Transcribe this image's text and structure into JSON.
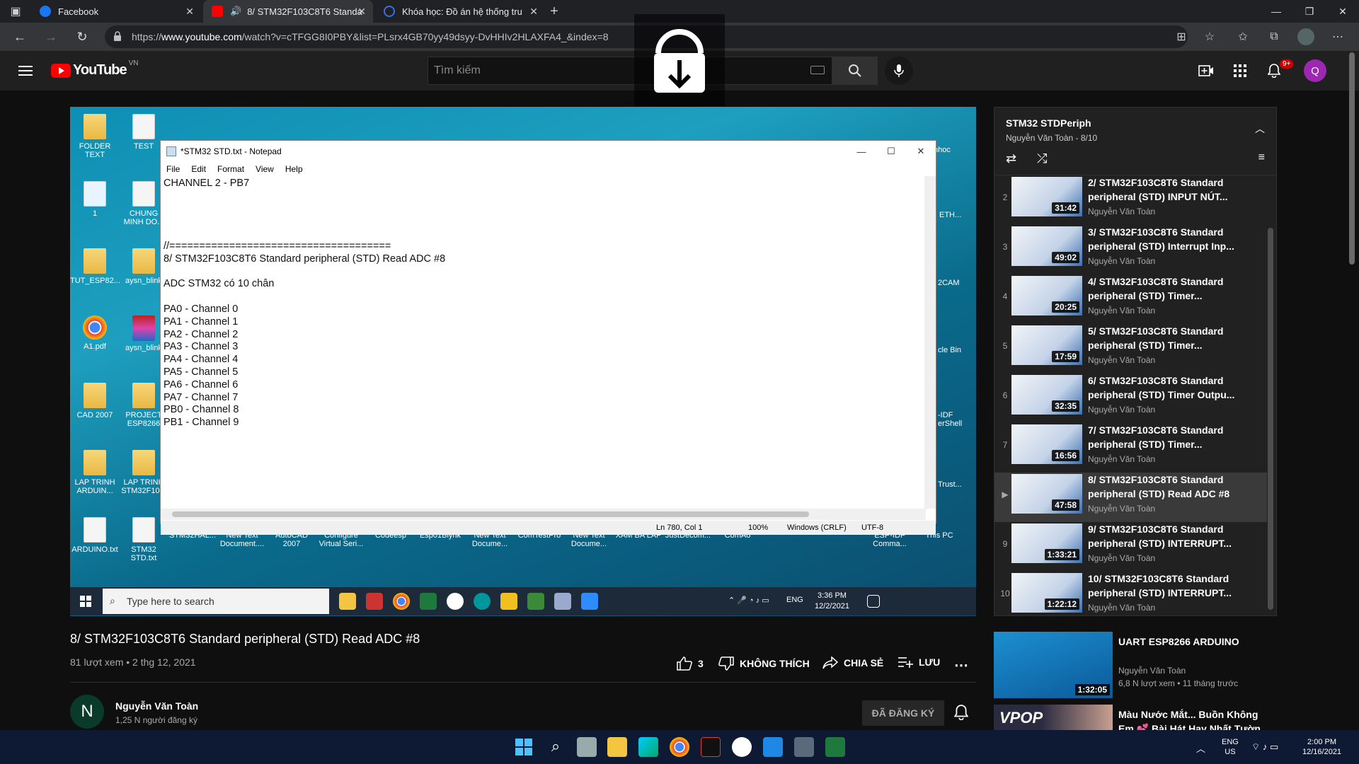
{
  "browser": {
    "tabs": [
      {
        "title": "Facebook",
        "color": "#1877f2"
      },
      {
        "title": "8/ STM32F103C8T6 Standa",
        "color": "#ff0000"
      },
      {
        "title": "Khóa học: Đồ án hệ thống truyề",
        "color": "#3b6fe0"
      }
    ],
    "url_prefix": "https://",
    "url_domain": "www.youtube.com",
    "url_path": "/watch?v=cTFGG8I0PBY&list=PLsrx4GB70yy49dsyy-DvHHIv2HLAXFA4_&index=8"
  },
  "youtube": {
    "logo_text": "YouTube",
    "country": "VN",
    "search_placeholder": "Tìm kiếm",
    "notif_badge": "9+",
    "avatar_letter": "Q"
  },
  "notepad": {
    "title": "*STM32 STD.txt - Notepad",
    "menu": [
      "File",
      "Edit",
      "Format",
      "View",
      "Help"
    ],
    "lines": [
      "CHANNEL 2 - PB7",
      "",
      "",
      "",
      "",
      "//=====================================",
      "8/ STM32F103C8T6 Standard peripheral (STD) Read ADC #8",
      "",
      "ADC STM32 có 10 chân",
      "",
      "PA0 - Channel 0",
      "PA1 - Channel 1",
      "PA2 - Channel 2",
      "PA3 - Channel 3",
      "PA4 - Channel 4",
      "PA5 - Channel 5",
      "PA6 - Channel 6",
      "PA7 - Channel 7",
      "PB0 - Channel 8",
      "PB1 - Channel 9"
    ],
    "status_pos": "Ln 780, Col 1",
    "status_zoom": "100%",
    "status_eol": "Windows (CRLF)",
    "status_enc": "UTF-8"
  },
  "desktop": {
    "icons": [
      {
        "label": "FOLDER TEXT"
      },
      {
        "label": "TEST"
      },
      {
        "label": "1"
      },
      {
        "label": "CHUNG MINH DO..."
      },
      {
        "label": "TUT_ESP82..."
      },
      {
        "label": "aysn_blink"
      },
      {
        "label": "A1.pdf"
      },
      {
        "label": "aysn_blink"
      },
      {
        "label": "CAD 2007"
      },
      {
        "label": "PROJECT ESP8266"
      },
      {
        "label": "LAP TRINH ARDUIN..."
      },
      {
        "label": "LAP TRINH STM32F10..."
      },
      {
        "label": "ARDUINO.txt"
      },
      {
        "label": "STM32 STD.txt"
      },
      {
        "label": "STM32HAL..."
      },
      {
        "label": "New Text Document...."
      },
      {
        "label": "AutoCAD 2007"
      },
      {
        "label": "Configure Virtual Seri..."
      },
      {
        "label": "Codeesp"
      },
      {
        "label": "Esp01Blynk"
      },
      {
        "label": "New Text Docume..."
      },
      {
        "label": "ComTestPro"
      },
      {
        "label": "New Text Docume..."
      },
      {
        "label": "XAM BA LAP"
      },
      {
        "label": "JustDecom..."
      },
      {
        "label": "ComAo"
      },
      {
        "label": "ESP-IDF Comma..."
      },
      {
        "label": "This PC"
      }
    ],
    "right_labels": [
      "nhoc",
      "ETH...",
      "2CAM",
      "cle Bin",
      "-IDF erShell",
      "Trust..."
    ],
    "search_placeholder": "Type here to search",
    "lang": "ENG",
    "time": "3:36 PM",
    "date": "12/2/2021"
  },
  "video": {
    "title": "8/ STM32F103C8T6 Standard peripheral (STD) Read ADC #8",
    "meta": "81 lượt xem • 2 thg 12, 2021",
    "likes": "3",
    "dislike_label": "KHÔNG THÍCH",
    "share_label": "CHIA SẺ",
    "save_label": "LƯU",
    "channel_name": "Nguyễn Văn Toàn",
    "channel_initial": "N",
    "subscribers": "1,25 N người đăng ký",
    "subscribed_label": "ĐÃ ĐĂNG KÝ"
  },
  "playlist": {
    "title": "STM32 STDPeriph",
    "subtitle": "Nguyễn Văn Toàn - 8/10",
    "items": [
      {
        "index": "2",
        "title": "2/ STM32F103C8T6 Standard peripheral (STD) INPUT NÚT...",
        "channel": "Nguyễn Văn Toàn",
        "duration": "31:42"
      },
      {
        "index": "3",
        "title": "3/ STM32F103C8T6 Standard peripheral (STD) Interrupt Inp...",
        "channel": "Nguyễn Văn Toàn",
        "duration": "49:02"
      },
      {
        "index": "4",
        "title": "4/ STM32F103C8T6 Standard peripheral (STD) Timer...",
        "channel": "Nguyễn Văn Toàn",
        "duration": "20:25"
      },
      {
        "index": "5",
        "title": "5/ STM32F103C8T6 Standard peripheral (STD) Timer...",
        "channel": "Nguyễn Văn Toàn",
        "duration": "17:59"
      },
      {
        "index": "6",
        "title": "6/ STM32F103C8T6 Standard peripheral (STD) Timer Outpu...",
        "channel": "Nguyễn Văn Toàn",
        "duration": "32:35"
      },
      {
        "index": "7",
        "title": "7/ STM32F103C8T6 Standard peripheral (STD) Timer...",
        "channel": "Nguyễn Văn Toàn",
        "duration": "16:56"
      },
      {
        "index": "▶",
        "title": "8/ STM32F103C8T6 Standard peripheral (STD) Read ADC #8",
        "channel": "Nguyễn Văn Toàn",
        "duration": "47:58"
      },
      {
        "index": "9",
        "title": "9/ STM32F103C8T6 Standard peripheral (STD) INTERRUPT...",
        "channel": "Nguyễn Văn Toàn",
        "duration": "1:33:21"
      },
      {
        "index": "10",
        "title": "10/ STM32F103C8T6 Standard peripheral (STD) INTERRUPT...",
        "channel": "Nguyễn Văn Toàn",
        "duration": "1:22:12"
      }
    ]
  },
  "recommendations": [
    {
      "title": "UART ESP8266 ARDUINO",
      "channel": "Nguyễn Văn Toàn",
      "meta": "6,8 N lượt xem • 11 tháng trước",
      "duration": "1:32:05"
    },
    {
      "title": "Màu Nước Mắt... Buồn Không Em 💕 Bài Hát Hay Nhất Tườn...",
      "channel": "",
      "meta": "",
      "duration": "",
      "thumb_text": "VPOP"
    }
  ],
  "os": {
    "lang_top": "ENG",
    "lang_bottom": "US",
    "time": "2:00 PM",
    "date": "12/16/2021"
  }
}
